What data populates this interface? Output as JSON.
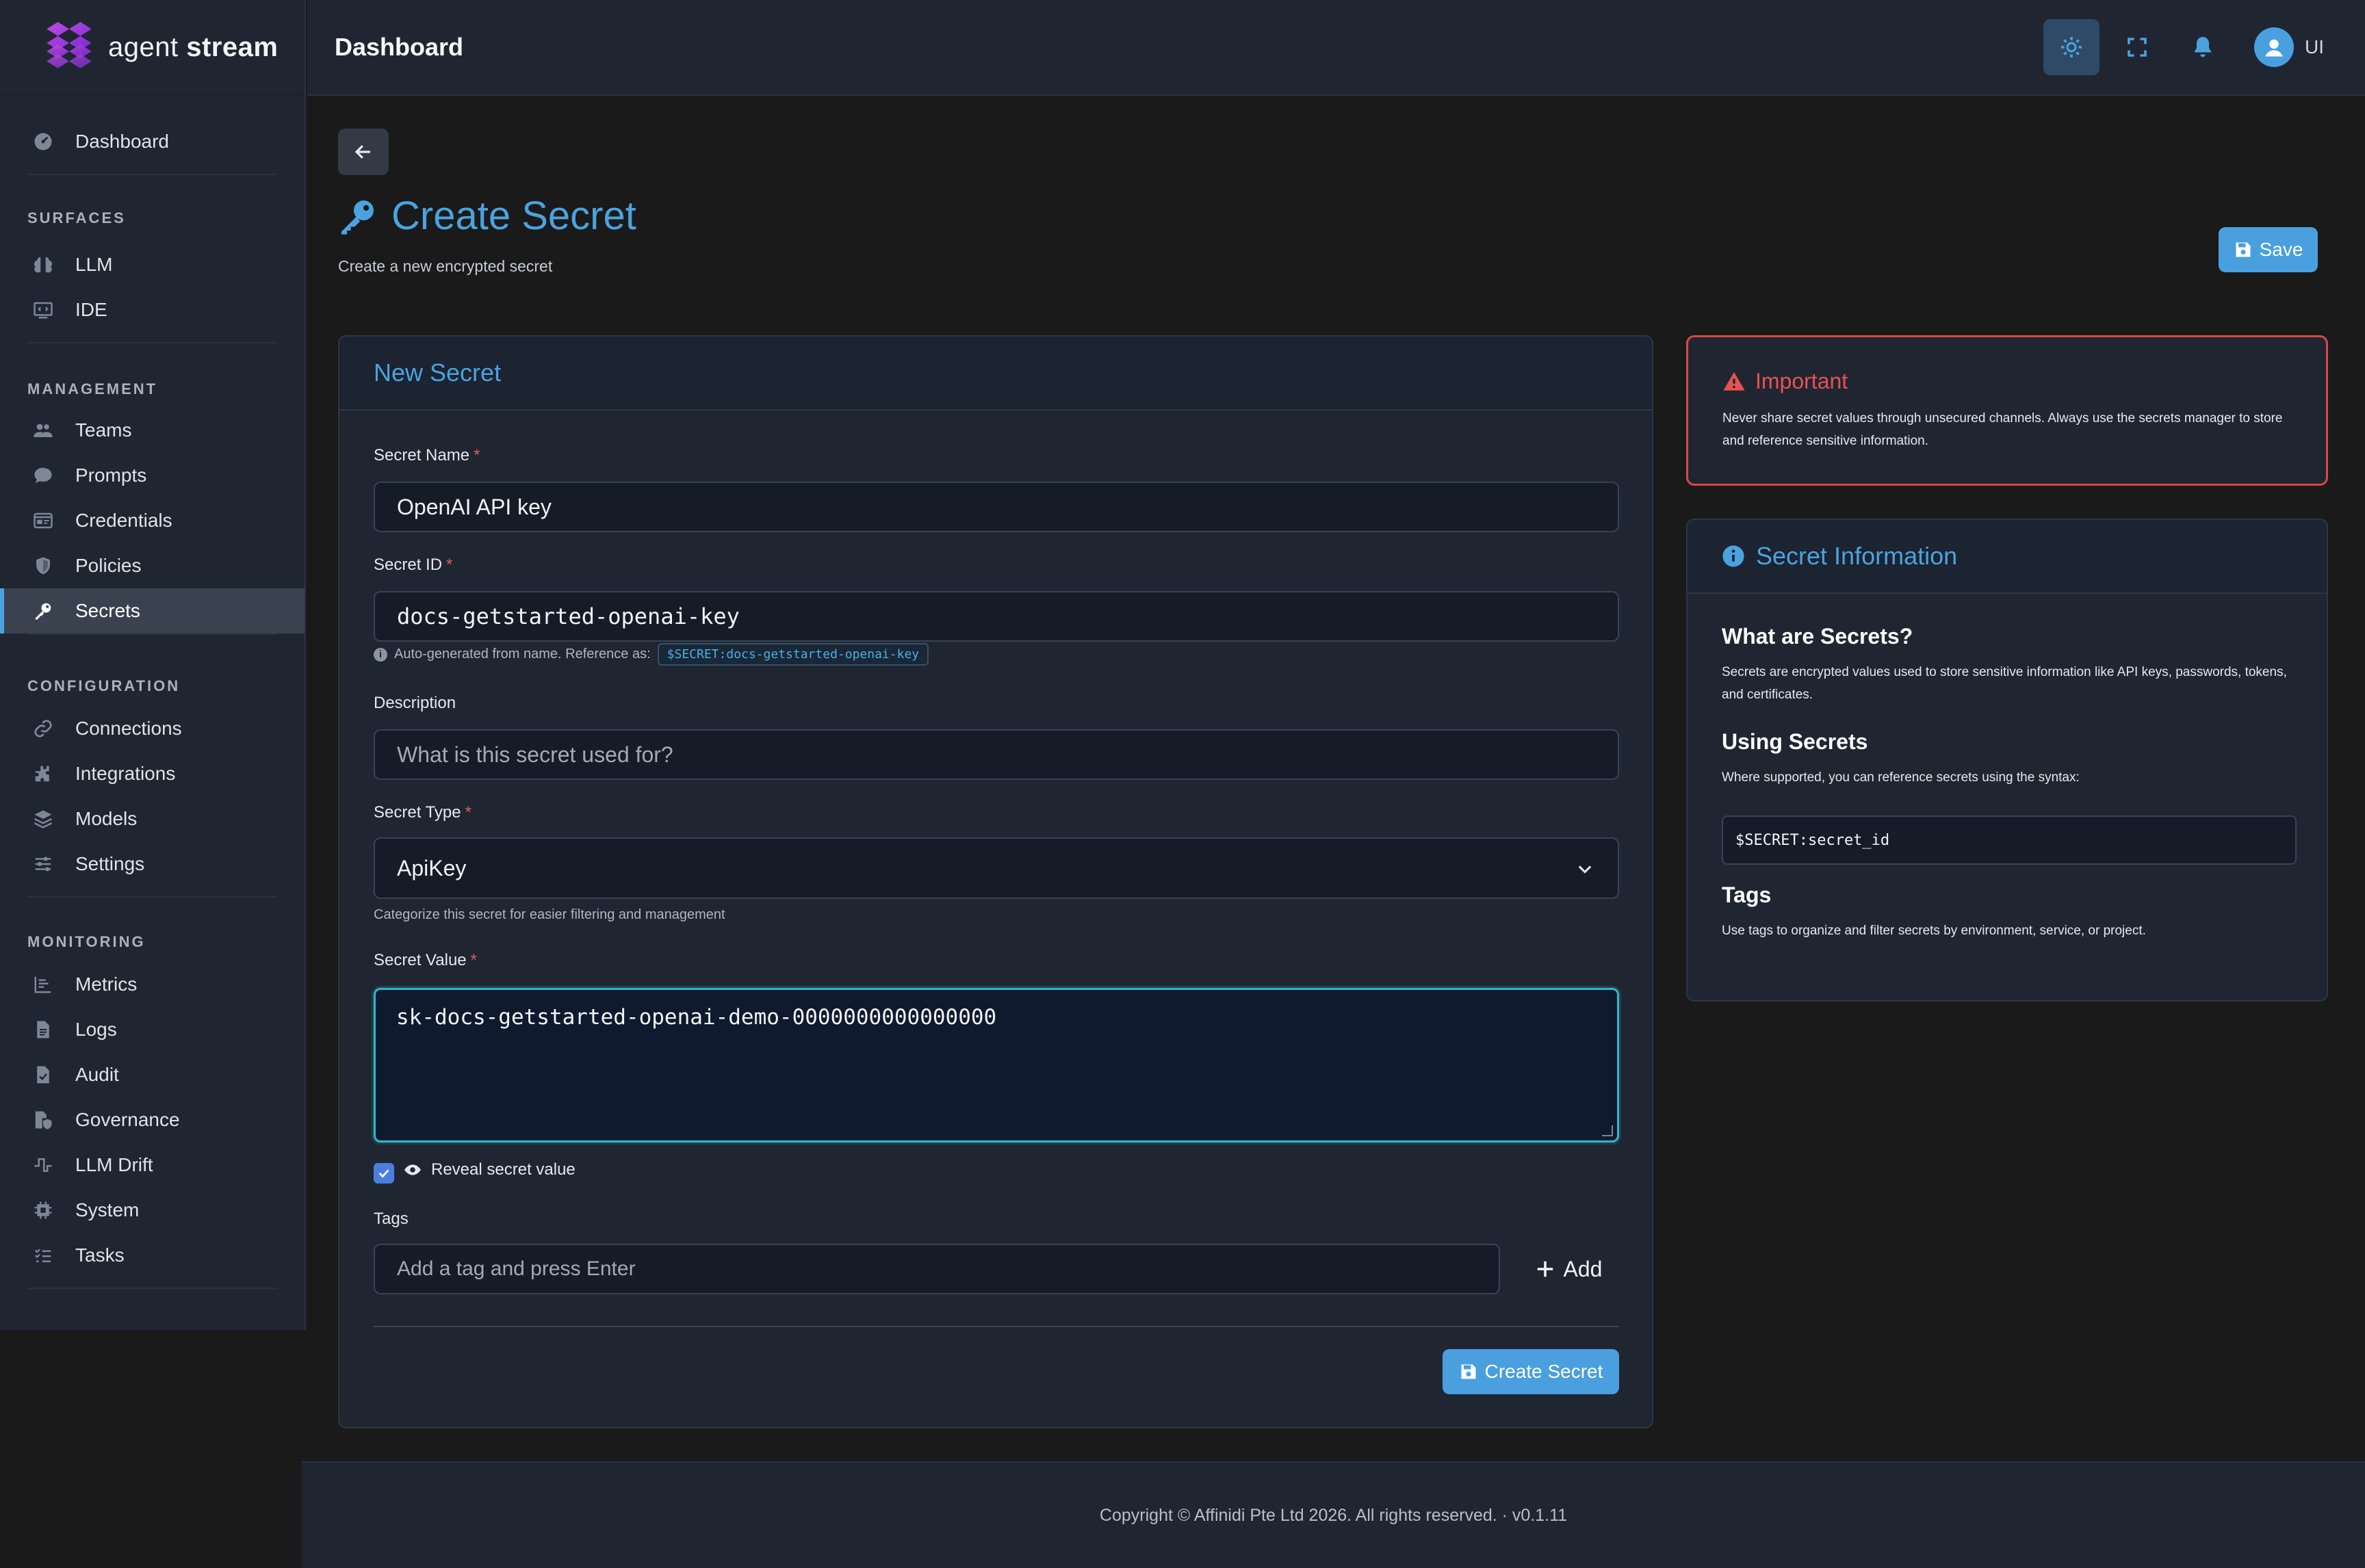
{
  "brand": {
    "name_light": "agent",
    "name_bold": "stream"
  },
  "topbar": {
    "title": "Dashboard",
    "user_initials": "UI"
  },
  "sidebar": {
    "dashboard": "Dashboard",
    "sections": [
      {
        "title": "SURFACES",
        "items": [
          "LLM",
          "IDE"
        ]
      },
      {
        "title": "MANAGEMENT",
        "items": [
          "Teams",
          "Prompts",
          "Credentials",
          "Policies",
          "Secrets"
        ]
      },
      {
        "title": "CONFIGURATION",
        "items": [
          "Connections",
          "Integrations",
          "Models",
          "Settings"
        ]
      },
      {
        "title": "MONITORING",
        "items": [
          "Metrics",
          "Logs",
          "Audit",
          "Governance",
          "LLM Drift",
          "System",
          "Tasks"
        ]
      }
    ],
    "active_item": "Secrets"
  },
  "page": {
    "title": "Create Secret",
    "subtitle": "Create a new encrypted secret",
    "save_label": "Save"
  },
  "form": {
    "card_title": "New Secret",
    "name_label": "Secret Name",
    "name_value": "OpenAI API key",
    "id_label": "Secret ID",
    "id_value": "docs-getstarted-openai-key",
    "id_hint": "Auto-generated from name. Reference as:",
    "id_reference": "$SECRET:docs-getstarted-openai-key",
    "description_label": "Description",
    "description_placeholder": "What is this secret used for?",
    "type_label": "Secret Type",
    "type_value": "ApiKey",
    "type_hint": "Categorize this secret for easier filtering and management",
    "value_label": "Secret Value",
    "value_value": "sk-docs-getstarted-openai-demo-0000000000000000",
    "reveal_label": "Reveal secret value",
    "reveal_checked": true,
    "tags_label": "Tags",
    "tags_placeholder": "Add a tag and press Enter",
    "add_label": "Add",
    "create_label": "Create Secret"
  },
  "important": {
    "title": "Important",
    "text": "Never share secret values through unsecured channels. Always use the secrets manager to store and reference sensitive information."
  },
  "info": {
    "title": "Secret Information",
    "h1": "What are Secrets?",
    "p1": "Secrets are encrypted values used to store sensitive information like API keys, passwords, tokens, and certificates.",
    "h2": "Using Secrets",
    "p2": "Where supported, you can reference secrets using the syntax:",
    "syntax": "$SECRET:secret_id",
    "h3": "Tags",
    "p3": "Use tags to organize and filter secrets by environment, service, or project."
  },
  "footer": {
    "text": "Copyright © Affinidi Pte Ltd 2026. All rights reserved. · v0.1.11"
  },
  "colors": {
    "accent": "#4aa3df",
    "danger": "#e85151",
    "focus": "#2fb7c9"
  }
}
